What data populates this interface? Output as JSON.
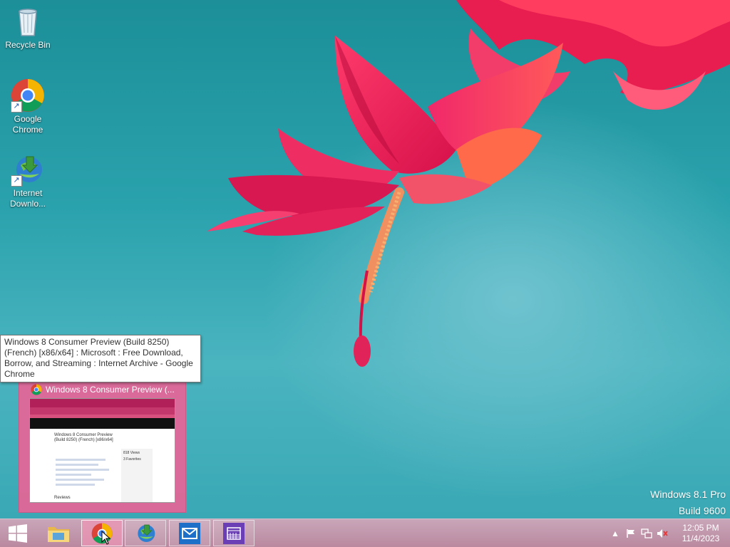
{
  "desktop": {
    "icons": [
      {
        "label": "Recycle Bin",
        "icon": "recycle-bin-icon"
      },
      {
        "label": "Google Chrome",
        "icon": "chrome-icon"
      },
      {
        "label": "Internet Downlo...",
        "icon": "idm-icon"
      }
    ],
    "watermark": {
      "line1": "Windows 8.1 Pro",
      "line2": "Build 9600"
    }
  },
  "tooltip": {
    "text": "Windows 8 Consumer Preview (Build 8250) (French) [x86/x64] : Microsoft : Free Download, Borrow, and Streaming : Internet Archive - Google Chrome"
  },
  "thumbnail": {
    "title": "Windows 8 Consumer Preview (...",
    "preview": {
      "page_title": "Windows 8 Consumer Preview (Build 8250) (French) [x86/x64]",
      "views": "818 Views",
      "favorites": "3 Favorites",
      "reviews": "Reviews"
    }
  },
  "taskbar": {
    "start": "windows-logo-icon",
    "pinned": [
      {
        "name": "file-explorer",
        "icon": "folder-icon",
        "state": "pinned"
      },
      {
        "name": "google-chrome",
        "icon": "chrome-icon",
        "state": "active"
      },
      {
        "name": "internet-download-manager",
        "icon": "idm-icon",
        "state": "open"
      },
      {
        "name": "mail",
        "icon": "mail-icon",
        "state": "open"
      },
      {
        "name": "calendar",
        "icon": "calendar-icon",
        "state": "open"
      }
    ],
    "tray": {
      "time": "12:05 PM",
      "date": "11/4/2023",
      "icons": [
        "show-hidden-icons-icon",
        "action-center-flag-icon",
        "network-icon",
        "volume-muted-icon"
      ]
    }
  },
  "colors": {
    "wallpaper": "#2aa2ad",
    "taskbar": "#c19aaf",
    "thumbnail": "#e6648f",
    "chrome_red": "#db4437",
    "chrome_yellow": "#f4b400",
    "chrome_green": "#0f9d58",
    "chrome_blue": "#4285f4"
  }
}
